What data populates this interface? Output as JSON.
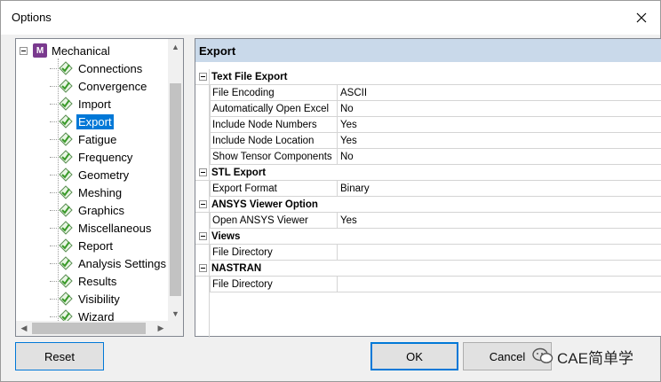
{
  "window": {
    "title": "Options"
  },
  "tree": {
    "root": {
      "icon_letter": "M",
      "label": "Mechanical"
    },
    "items": [
      {
        "label": "Connections"
      },
      {
        "label": "Convergence"
      },
      {
        "label": "Import"
      },
      {
        "label": "Export",
        "selected": true
      },
      {
        "label": "Fatigue"
      },
      {
        "label": "Frequency"
      },
      {
        "label": "Geometry"
      },
      {
        "label": "Meshing"
      },
      {
        "label": "Graphics"
      },
      {
        "label": "Miscellaneous"
      },
      {
        "label": "Report"
      },
      {
        "label": "Analysis Settings ar"
      },
      {
        "label": "Results"
      },
      {
        "label": "Visibility"
      },
      {
        "label": "Wizard"
      }
    ]
  },
  "panel": {
    "header": "Export",
    "categories": [
      {
        "label": "Text File Export",
        "props": [
          {
            "name": "File Encoding",
            "value": "ASCII"
          },
          {
            "name": "Automatically Open Excel",
            "value": "No"
          },
          {
            "name": "Include Node Numbers",
            "value": "Yes"
          },
          {
            "name": "Include Node Location",
            "value": "Yes"
          },
          {
            "name": "Show Tensor Components",
            "value": "No"
          }
        ]
      },
      {
        "label": "STL Export",
        "props": [
          {
            "name": "Export Format",
            "value": "Binary"
          }
        ]
      },
      {
        "label": "ANSYS Viewer Option",
        "props": [
          {
            "name": "Open ANSYS Viewer",
            "value": "Yes"
          }
        ]
      },
      {
        "label": "Views",
        "props": [
          {
            "name": "File Directory",
            "value": ""
          }
        ]
      },
      {
        "label": "NASTRAN",
        "props": [
          {
            "name": "File Directory",
            "value": ""
          }
        ]
      }
    ]
  },
  "buttons": {
    "reset": "Reset",
    "ok": "OK",
    "cancel": "Cancel"
  },
  "watermark": "CAE简单学",
  "colors": {
    "selection": "#0078d7",
    "header_bg": "#c9d9ea",
    "check_green": "#3a9a2a"
  }
}
